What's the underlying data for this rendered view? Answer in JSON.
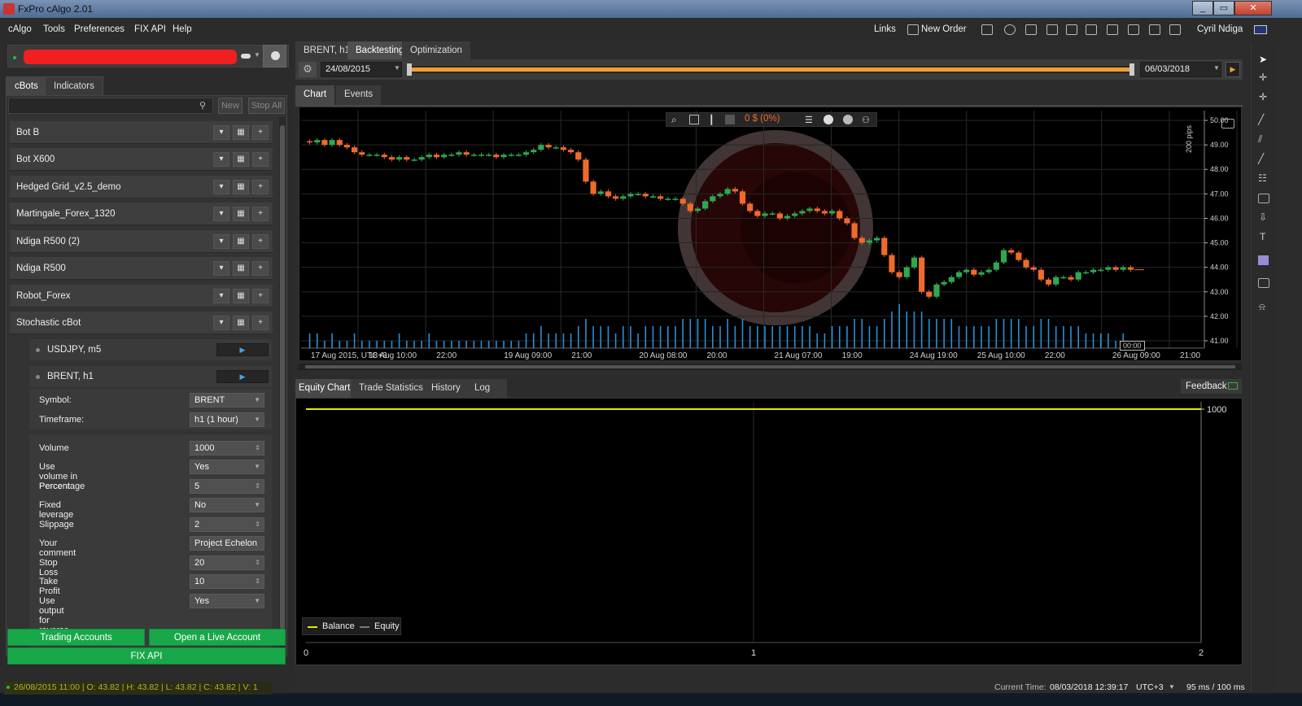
{
  "window": {
    "title": "FxPro cAlgo 2.01",
    "min": "_",
    "max": "▭",
    "close": "✕"
  },
  "menu": {
    "items": [
      "cAlgo",
      "Tools",
      "Preferences",
      "FIX API",
      "Help"
    ]
  },
  "toolbar": {
    "links": "Links",
    "new_order": "New Order",
    "user": "Cyril Ndiga"
  },
  "left": {
    "tabs": [
      "cBots",
      "Indicators"
    ],
    "search_placeholder": "",
    "new": "New",
    "stop_all": "Stop All",
    "bots": [
      "Bot B",
      "Bot X600",
      "Hedged Grid_v2.5_demo",
      "Martingale_Forex_1320",
      "Ndiga R500 (2)",
      "Ndiga R500",
      "Robot_Forex",
      "Stochastic cBot"
    ],
    "instances": [
      "USDJPY, m5",
      "BRENT, h1"
    ],
    "params": [
      {
        "label": "Symbol:",
        "value": "BRENT",
        "kind": "select"
      },
      {
        "label": "Timeframe:",
        "value": "h1 (1 hour)",
        "kind": "select"
      },
      {
        "label": "Volume",
        "value": "1000",
        "kind": "spin"
      },
      {
        "label": "Use volume in Percentage",
        "value": "Yes",
        "kind": "select"
      },
      {
        "label": "Percent",
        "value": "5",
        "kind": "spin"
      },
      {
        "label": "Fixed leverage",
        "value": "No",
        "kind": "select"
      },
      {
        "label": "Slippage",
        "value": "2",
        "kind": "spin"
      },
      {
        "label": "Your comment",
        "value": "Project Echelon",
        "kind": "text"
      },
      {
        "label": "Stop Loss",
        "value": "20",
        "kind": "spin"
      },
      {
        "label": "Take Profit",
        "value": "10",
        "kind": "spin"
      },
      {
        "label": "Use output for reverse signal",
        "value": "Yes",
        "kind": "select"
      }
    ],
    "trading_accounts": "Trading Accounts",
    "open_live": "Open a Live Account",
    "fix_api": "FIX API"
  },
  "backtest": {
    "tabs": [
      "BRENT, h1",
      "Backtesting",
      "Optimization"
    ],
    "start_date": "24/08/2015",
    "end_date": "06/03/2018",
    "chart_tabs": [
      "Chart",
      "Events"
    ],
    "pnl": "0 $ (0%)",
    "pips_label": "200 pips",
    "time_marker": "00:00"
  },
  "bottom": {
    "tabs": [
      "Equity Chart",
      "Trade Statistics",
      "History",
      "Log"
    ],
    "feedback": "Feedback",
    "legend": [
      "Balance",
      "Equity"
    ]
  },
  "status": {
    "bar_info": "26/08/2015 11:00 | O: 43.82 | H: 43.82 | L: 43.82 | C: 43.82 | V: 1",
    "current_time_label": "Current Time:",
    "current_time": "08/03/2018 12:39:17",
    "tz": "UTC+3",
    "latency": "95 ms / 100 ms"
  },
  "colors": {
    "accent": "#f0a030",
    "bull": "#2fa84f",
    "bear": "#f06a2a",
    "volume": "#2a8fd6",
    "equity": "#e8e800",
    "green_button": "#18a84a"
  },
  "chart_data": [
    {
      "type": "candlestick",
      "symbol": "BRENT",
      "timeframe": "h1",
      "x_tick_labels": [
        "17 Aug 2015, UTC+3",
        "18 Aug 10:00",
        "22:00",
        "19 Aug 09:00",
        "21:00",
        "20 Aug 08:00",
        "20:00",
        "21 Aug 07:00",
        "19:00",
        "24 Aug 19:00",
        "25 Aug 10:00",
        "22:00",
        "26 Aug 09:00",
        "21:00"
      ],
      "y_ticks": [
        "50.00",
        "49.00",
        "48.00",
        "47.00",
        "46.00",
        "45.00",
        "44.00",
        "43.00",
        "42.00",
        "41.00"
      ],
      "ylim": [
        40.7,
        50.4
      ],
      "close": [
        49.1,
        49.2,
        49.0,
        49.2,
        49.0,
        48.9,
        48.7,
        48.6,
        48.6,
        48.6,
        48.5,
        48.4,
        48.5,
        48.4,
        48.4,
        48.5,
        48.6,
        48.5,
        48.6,
        48.6,
        48.7,
        48.6,
        48.6,
        48.6,
        48.6,
        48.5,
        48.6,
        48.6,
        48.6,
        48.7,
        48.8,
        49.0,
        48.9,
        48.9,
        48.8,
        48.7,
        48.4,
        47.5,
        47.0,
        47.1,
        46.9,
        46.8,
        46.9,
        47.0,
        47.0,
        46.9,
        46.9,
        46.8,
        46.8,
        46.8,
        46.6,
        46.3,
        46.4,
        46.7,
        46.9,
        47.0,
        47.2,
        47.1,
        46.6,
        46.3,
        46.1,
        46.2,
        46.2,
        46.0,
        46.1,
        46.2,
        46.3,
        46.4,
        46.3,
        46.2,
        46.3,
        46.0,
        45.8,
        45.2,
        45.0,
        45.1,
        45.2,
        44.5,
        43.8,
        43.6,
        44.0,
        44.4,
        43.0,
        42.8,
        43.3,
        43.4,
        43.6,
        43.8,
        43.9,
        43.7,
        43.8,
        43.9,
        44.2,
        44.7,
        44.6,
        44.3,
        44.0,
        43.9,
        43.5,
        43.3,
        43.6,
        43.6,
        43.5,
        43.8,
        43.8,
        43.9,
        43.9,
        44.0,
        43.9,
        44.0,
        43.9
      ],
      "volume": [
        2,
        2,
        1,
        2,
        1,
        1,
        2,
        1,
        1,
        1,
        1,
        1,
        2,
        1,
        1,
        1,
        2,
        1,
        1,
        1,
        1,
        1,
        1,
        1,
        1,
        1,
        1,
        1,
        1,
        2,
        2,
        3,
        2,
        2,
        2,
        2,
        3,
        4,
        3,
        3,
        3,
        2,
        3,
        3,
        2,
        3,
        3,
        3,
        3,
        3,
        4,
        4,
        4,
        4,
        3,
        3,
        4,
        3,
        4,
        3,
        3,
        3,
        3,
        3,
        3,
        3,
        3,
        3,
        2,
        2,
        3,
        3,
        3,
        4,
        4,
        3,
        3,
        4,
        5,
        6,
        5,
        5,
        5,
        4,
        4,
        4,
        4,
        3,
        3,
        3,
        3,
        3,
        4,
        4,
        4,
        4,
        3,
        3,
        4,
        4,
        3,
        3,
        3,
        3,
        2,
        2,
        2,
        2,
        1,
        2,
        1
      ]
    },
    {
      "type": "line",
      "title": "Equity Chart",
      "x_ticks": [
        "0",
        "1",
        "2"
      ],
      "y_ticks": [
        "1000"
      ],
      "series": [
        {
          "name": "Balance",
          "x": [
            0,
            2
          ],
          "values": [
            1000,
            1000
          ]
        },
        {
          "name": "Equity",
          "x": [
            0,
            2
          ],
          "values": [
            1000,
            1000
          ]
        }
      ]
    }
  ]
}
